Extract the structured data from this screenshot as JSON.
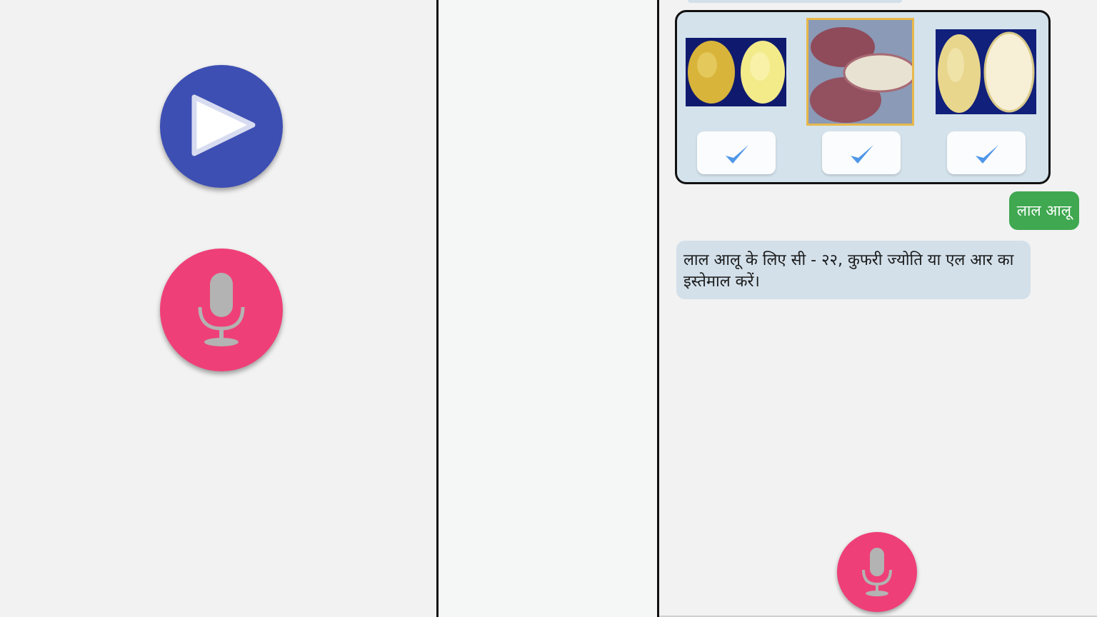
{
  "left_panel": {
    "play_button": {
      "icon": "play-icon",
      "color": "#3d4fb3"
    },
    "mic_button": {
      "icon": "mic-icon",
      "color": "#ef3f78"
    }
  },
  "chat": {
    "options": [
      {
        "image": "potato-yellow-cut",
        "check_icon": "check-icon"
      },
      {
        "image": "potato-red-cut",
        "check_icon": "check-icon",
        "selected": true
      },
      {
        "image": "potato-cream-cut",
        "check_icon": "check-icon"
      }
    ],
    "user_message": "लाल आलू",
    "bot_message": "लाल आलू के लिए सी - २२, कुफरी ज्योति या एल आर का इस्तेमाल करें।",
    "mic_button": {
      "icon": "mic-icon",
      "color": "#ef3f78"
    }
  },
  "colors": {
    "user_bubble": "#3fa850",
    "bot_bubble": "#d3e0ea",
    "check": "#4f97e8",
    "selected_border": "#e8b84a"
  }
}
